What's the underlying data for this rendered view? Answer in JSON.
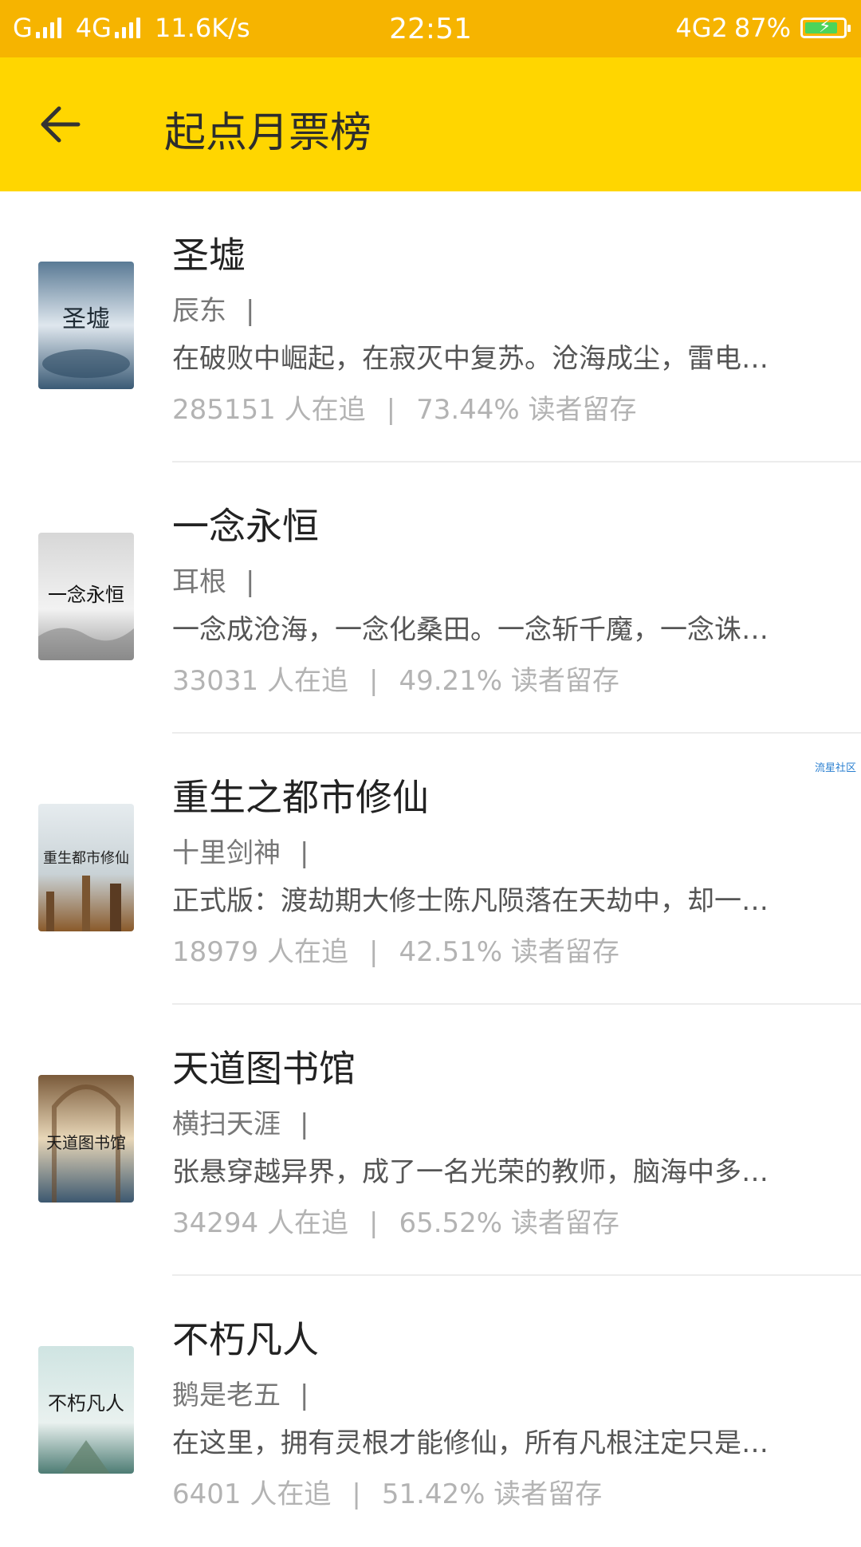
{
  "status_bar": {
    "carrier1": "G",
    "carrier2": "4G",
    "speed": "11.6K/s",
    "time": "22:51",
    "network_right": "4G2",
    "battery": "87%",
    "battery_level": 0.87,
    "battery_color": "#4cd45a"
  },
  "app_bar": {
    "back_icon": "arrow-left-icon",
    "title": "起点月票榜",
    "color": "#ffd600"
  },
  "books": [
    {
      "title": "圣墟",
      "author": "辰东",
      "separator": "|",
      "description": "在破败中崛起，在寂灭中复苏。沧海成尘，雷电…",
      "followers": "285151 人在追",
      "retention": "73.44% 读者留存",
      "cover_text": "圣墟"
    },
    {
      "title": "一念永恒",
      "author": "耳根",
      "separator": "|",
      "description": "一念成沧海，一念化桑田。一念斩千魔，一念诛…",
      "followers": "33031 人在追",
      "retention": "49.21% 读者留存",
      "cover_text": "一念永恒"
    },
    {
      "title": "重生之都市修仙",
      "author": "十里剑神",
      "separator": "|",
      "description": "正式版：渡劫期大修士陈凡陨落在天劫中，却一…",
      "followers": "18979 人在追",
      "retention": "42.51% 读者留存",
      "cover_text": "重生都市修仙"
    },
    {
      "title": "天道图书馆",
      "author": "横扫天涯",
      "separator": "|",
      "description": "张悬穿越异界，成了一名光荣的教师，脑海中多…",
      "followers": "34294 人在追",
      "retention": "65.52% 读者留存",
      "cover_text": "天道图书馆"
    },
    {
      "title": "不朽凡人",
      "author": "鹅是老五",
      "separator": "|",
      "description": "在这里，拥有灵根才能修仙，所有凡根注定只是…",
      "followers": "6401 人在追",
      "retention": "51.42% 读者留存",
      "cover_text": "不朽凡人"
    }
  ],
  "stats_separator": "|",
  "watermark": "流星社区"
}
